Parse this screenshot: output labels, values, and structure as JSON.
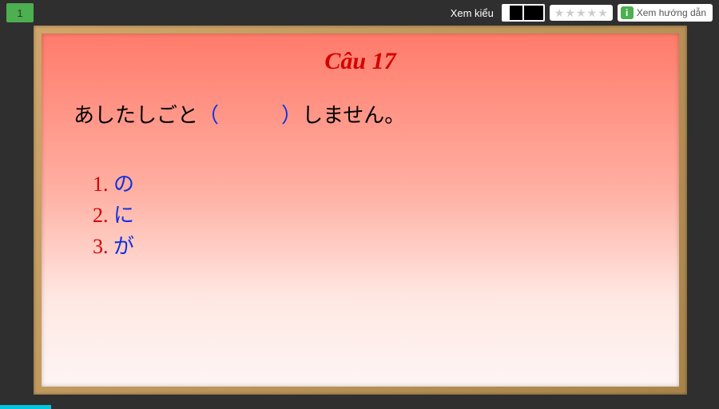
{
  "topbar": {
    "number": "1",
    "view_label": "Xem kiểu",
    "guide_label": "Xem hướng dẫn"
  },
  "question": {
    "title": "Câu 17",
    "sentence_pre": "あしたしごと",
    "paren_open": "（",
    "paren_space": "　　　",
    "paren_close": "）",
    "sentence_post": "しません。",
    "options": [
      {
        "num": "1.",
        "text": "の"
      },
      {
        "num": "2.",
        "text": "に"
      },
      {
        "num": "3.",
        "text": "が"
      }
    ]
  }
}
